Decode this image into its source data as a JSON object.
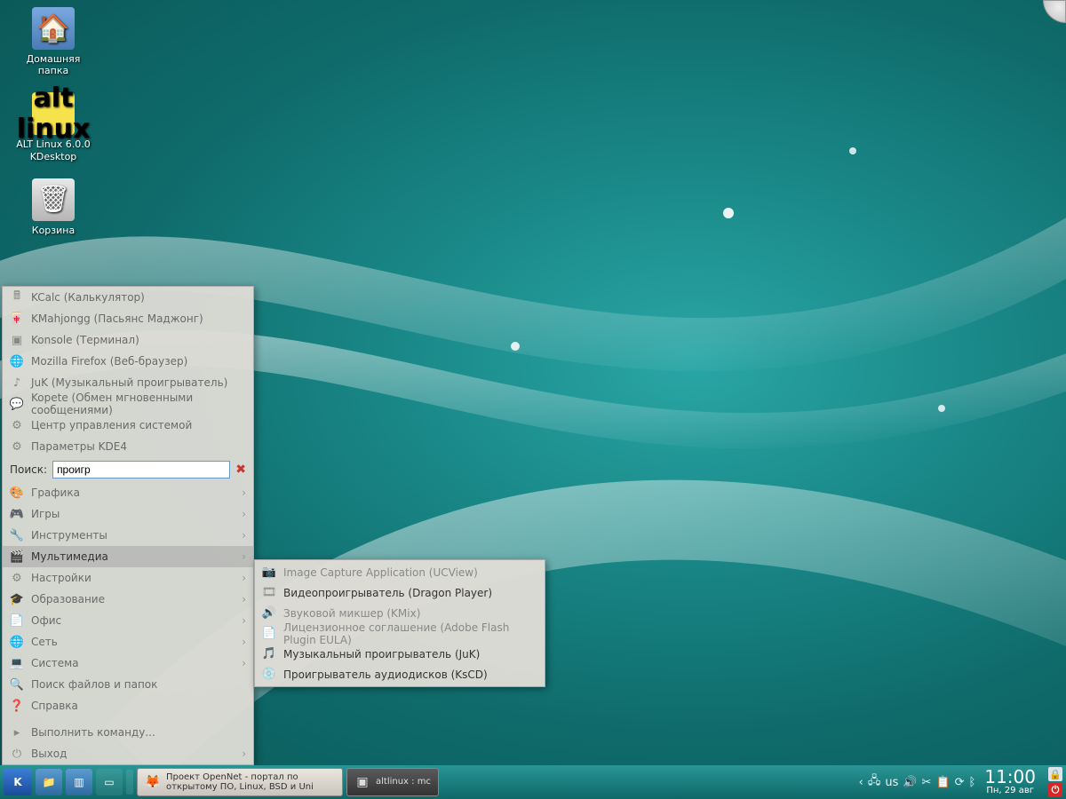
{
  "desktop": {
    "icons": [
      {
        "id": "home-folder",
        "label": "Домашняя\nпапка"
      },
      {
        "id": "altlinux-release",
        "label": "ALT Linux 6.0.0\nKDesktop"
      },
      {
        "id": "trash",
        "label": "Корзина"
      }
    ]
  },
  "kmenu": {
    "favorites": [
      {
        "icon": "calc",
        "label": "KCalc (Калькулятор)"
      },
      {
        "icon": "mahjongg",
        "label": "KMahjongg (Пасьянс Маджонг)"
      },
      {
        "icon": "konsole",
        "label": "Konsole (Терминал)"
      },
      {
        "icon": "firefox",
        "label": "Mozilla Firefox (Веб-браузер)"
      },
      {
        "icon": "juk",
        "label": "JuK (Музыкальный проигрыватель)"
      },
      {
        "icon": "kopete",
        "label": "Kopete (Обмен мгновенными сообщениями)"
      },
      {
        "icon": "syssettings",
        "label": "Центр управления системой"
      },
      {
        "icon": "kde",
        "label": "Параметры KDE4"
      }
    ],
    "search": {
      "label": "Поиск:",
      "value": "проигр"
    },
    "categories": [
      {
        "icon": "graphics",
        "label": "Графика"
      },
      {
        "icon": "games",
        "label": "Игры"
      },
      {
        "icon": "tools",
        "label": "Инструменты"
      },
      {
        "icon": "multimedia",
        "label": "Мультимедиа",
        "selected": true
      },
      {
        "icon": "settings",
        "label": "Настройки"
      },
      {
        "icon": "education",
        "label": "Образование"
      },
      {
        "icon": "office",
        "label": "Офис"
      },
      {
        "icon": "network",
        "label": "Сеть"
      },
      {
        "icon": "system",
        "label": "Система"
      },
      {
        "icon": "find",
        "label": "Поиск файлов и папок"
      },
      {
        "icon": "help",
        "label": "Справка"
      }
    ],
    "actions": [
      {
        "icon": "run",
        "label": "Выполнить команду..."
      },
      {
        "icon": "exit",
        "label": "Выход"
      }
    ]
  },
  "submenu": {
    "items": [
      {
        "label": "Image Capture Application (UCView)",
        "matched": false
      },
      {
        "label": "Видеопроигрыватель (Dragon Player)",
        "matched": true
      },
      {
        "label": "Звуковой микшер (KMix)",
        "matched": false
      },
      {
        "label": "Лицензионное соглашение (Adobe Flash Plugin EULA)",
        "matched": false
      },
      {
        "label": "Музыкальный проигрыватель (JuK)",
        "matched": true
      },
      {
        "label": "Проигрыватель аудиодисков (KsCD)",
        "matched": true
      }
    ]
  },
  "taskbar": {
    "tasks": [
      {
        "icon": "firefox",
        "label": "Проект OpenNet - портал по открытому ПО, Linux, BSD и Uni"
      },
      {
        "icon": "terminal",
        "label": "altlinux : mc",
        "dark": true
      }
    ],
    "systray": {
      "network_icon": "network",
      "layout": "us",
      "volume_icon": "volume",
      "clipboard_icon": "clipboard",
      "klipper_icon": "scissors",
      "updates_icon": "updates",
      "bluetooth_icon": "bluetooth",
      "expand_icon": "expand"
    },
    "clock": {
      "time": "11:00",
      "date": "Пн, 29 авг"
    }
  }
}
